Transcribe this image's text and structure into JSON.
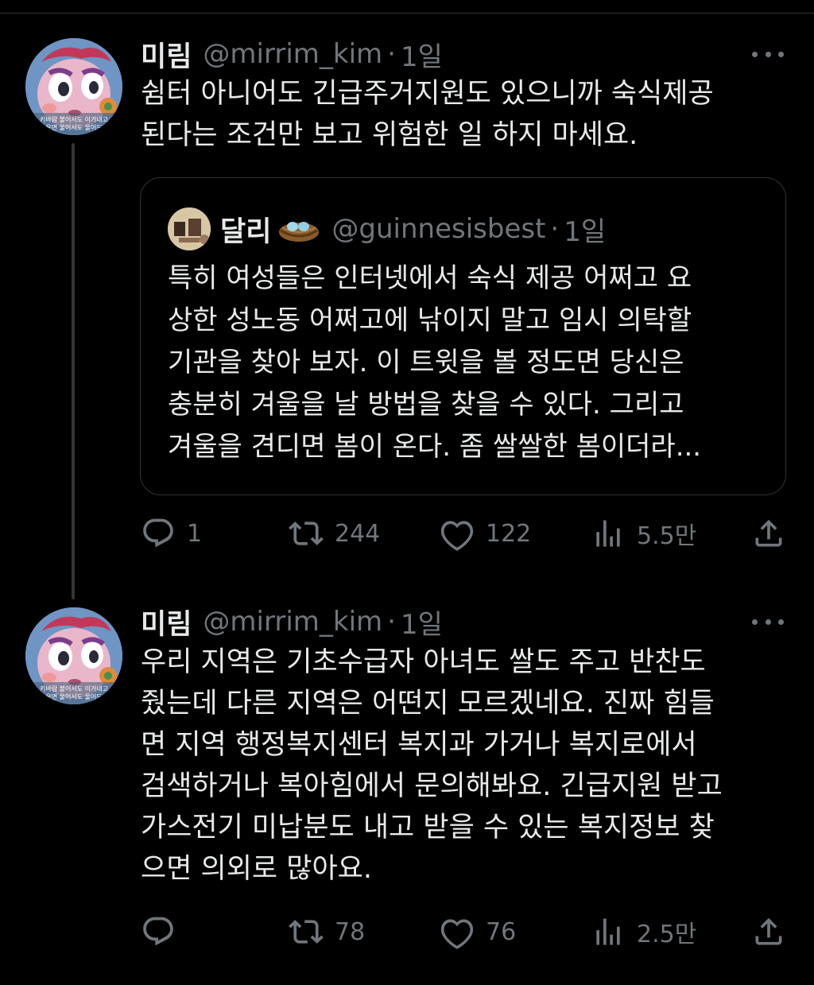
{
  "tweets": [
    {
      "name": "미림",
      "handle": "@mirrim_kim",
      "separator": "·",
      "time": "1일",
      "text": "쉼터 아니어도 긴급주거지원도 있으니까 숙식제공\n된다는 조건만 보고 위험한 일 하지 마세요.",
      "avatar_caption_1": "키바람 불어서도 이거내고",
      "avatar_caption_2": "우면 울어서도 울어도",
      "quote": {
        "name": "달리",
        "emoji": "bird-nest-with-eggs",
        "handle": "@guinnesisbest",
        "separator": "·",
        "time": "1일",
        "text": "특히 여성들은 인터넷에서 숙식 제공 어쩌고 요\n상한 성노동 어쩌고에 낚이지 말고 임시 의탁할\n기관을 찾아 보자. 이 트윗을 볼 정도면 당신은\n충분히 겨울을 날 방법을 찾을 수 있다. 그리고\n겨울을 견디면 봄이 온다. 좀 쌀쌀한 봄이더라..."
      },
      "stats": {
        "replies": "1",
        "retweets": "244",
        "likes": "122",
        "views": "5.5만"
      }
    },
    {
      "name": "미림",
      "handle": "@mirrim_kim",
      "separator": "·",
      "time": "1일",
      "text": "우리 지역은 기초수급자 아녀도 쌀도 주고 반찬도\n줬는데 다른 지역은 어떤지 모르겠네요. 진짜 힘들\n면 지역 행정복지센터 복지과 가거나 복지로에서\n검색하거나 복아힘에서 문의해봐요. 긴급지원 받고\n가스전기 미납분도 내고 받을 수 있는 복지정보 찾\n으면 의외로 많아요.",
      "avatar_caption_1": "키바람 불어서도 이거내고",
      "avatar_caption_2": "우면 울어서도 울어도",
      "stats": {
        "replies": "",
        "retweets": "78",
        "likes": "76",
        "views": "2.5만"
      }
    }
  ],
  "colors": {
    "background": "#000000",
    "text": "#e7e9ea",
    "muted": "#71767b",
    "border": "#2f3336"
  }
}
